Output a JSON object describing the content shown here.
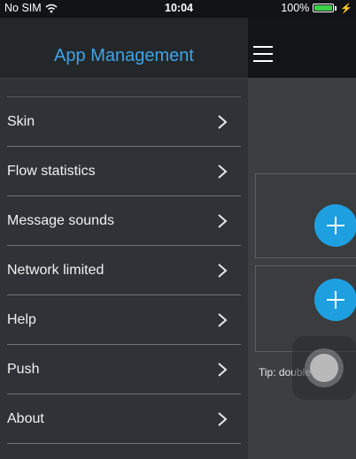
{
  "status_bar": {
    "carrier": "No SIM",
    "time": "10:04",
    "battery_percent": "100%",
    "battery_level": 1.0,
    "icons": [
      "wifi-icon",
      "battery-icon",
      "charging-bolt-icon"
    ]
  },
  "drawer": {
    "title": "App Management",
    "title_color": "#3ea3e8",
    "items": [
      {
        "label": "Skin",
        "icon": "chevron-right-icon"
      },
      {
        "label": "Flow statistics",
        "icon": "chevron-right-icon"
      },
      {
        "label": "Message sounds",
        "icon": "chevron-right-icon"
      },
      {
        "label": "Network limited",
        "icon": "chevron-right-icon"
      },
      {
        "label": "Help",
        "icon": "chevron-right-icon"
      },
      {
        "label": "Push",
        "icon": "chevron-right-icon"
      },
      {
        "label": "About",
        "icon": "chevron-right-icon"
      }
    ]
  },
  "content": {
    "menu_icon": "hamburger-menu-icon",
    "add_button_color": "#1ea0e0",
    "tip": "Tip: double click"
  }
}
